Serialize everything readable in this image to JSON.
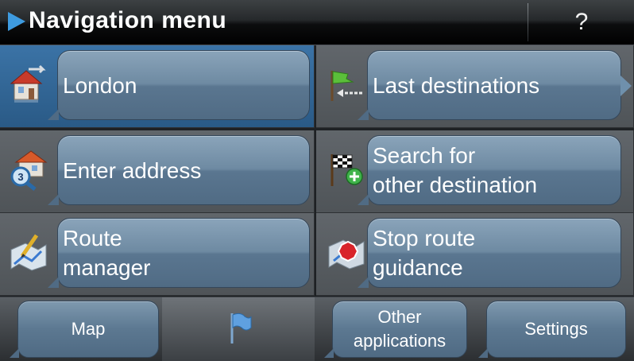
{
  "header": {
    "title": "Navigation menu",
    "help_label": "?"
  },
  "menu": {
    "items": [
      {
        "label_lines": [
          "London"
        ],
        "icon": "home-icon",
        "active": true
      },
      {
        "label_lines": [
          "Last destinations"
        ],
        "icon": "last-destination-flag-icon",
        "active": false
      },
      {
        "label_lines": [
          "Enter address"
        ],
        "icon": "address-search-icon",
        "active": false
      },
      {
        "label_lines": [
          "Search for",
          "other destination"
        ],
        "icon": "checkered-flag-plus-icon",
        "active": false
      },
      {
        "label_lines": [
          "Route",
          "manager"
        ],
        "icon": "route-map-pencil-icon",
        "active": false
      },
      {
        "label_lines": [
          "Stop route",
          "guidance"
        ],
        "icon": "stop-sign-map-icon",
        "active": false
      }
    ]
  },
  "bottom": {
    "map_label": "Map",
    "other_lines": [
      "Other",
      "applications"
    ],
    "settings_label": "Settings"
  },
  "colors": {
    "accent": "#3e9be0",
    "active_cell": "#3b73a6",
    "bubble": "#6e8aa2"
  }
}
